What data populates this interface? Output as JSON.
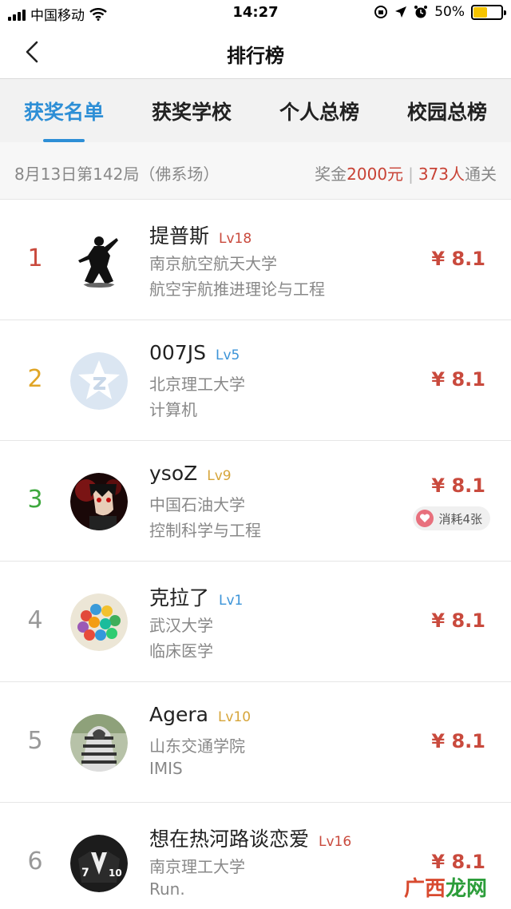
{
  "status_bar": {
    "carrier": "中国移动",
    "time": "14:27",
    "battery": "50%",
    "battery_level": 0.5
  },
  "nav": {
    "title": "排行榜",
    "back_icon": "chevron-left-icon"
  },
  "tabs": [
    {
      "label": "获奖名单",
      "active": true
    },
    {
      "label": "获奖学校",
      "active": false
    },
    {
      "label": "个人总榜",
      "active": false
    },
    {
      "label": "校园总榜",
      "active": false
    }
  ],
  "info": {
    "round": "8月13日第142局（佛系场）",
    "prize_prefix": "奖金",
    "prize_amount": "2000元",
    "winners_count": "373人",
    "winners_suffix": "通关",
    "separator": "|"
  },
  "rows": [
    {
      "rank": "1",
      "name": "提普斯",
      "level": "Lv18",
      "school": "南京航空航天大学",
      "major": "航空宇航推进理论与工程",
      "prize": "¥ 8.1",
      "avatar": "ninja-avatar"
    },
    {
      "rank": "2",
      "name": "007JS",
      "level": "Lv5",
      "school": "北京理工大学",
      "major": "计算机",
      "prize": "¥ 8.1",
      "avatar": "default-avatar"
    },
    {
      "rank": "3",
      "name": "ysoZ",
      "level": "Lv9",
      "school": "中国石油大学",
      "major": "控制科学与工程",
      "prize": "¥ 8.1",
      "avatar": "anime-avatar",
      "badge": "消耗4张"
    },
    {
      "rank": "4",
      "name": "克拉了",
      "level": "Lv1",
      "school": "武汉大学",
      "major": "临床医学",
      "prize": "¥ 8.1",
      "avatar": "balls-avatar"
    },
    {
      "rank": "5",
      "name": "Agera",
      "level": "Lv10",
      "school": "山东交通学院",
      "major": "IMIS",
      "prize": "¥ 8.1",
      "avatar": "hoodie-avatar"
    },
    {
      "rank": "6",
      "name": "想在热河路谈恋爱",
      "level": "Lv16",
      "school": "南京理工大学",
      "major": "Run.",
      "prize": "¥ 8.1",
      "avatar": "jersey-avatar"
    }
  ],
  "watermark": {
    "part1": "广西",
    "part2": "龙网"
  },
  "colors": {
    "accent": "#2e8fd6",
    "prize_red": "#c94a3d",
    "rank_gold": "#e0a526",
    "rank_green": "#3ea83e"
  }
}
